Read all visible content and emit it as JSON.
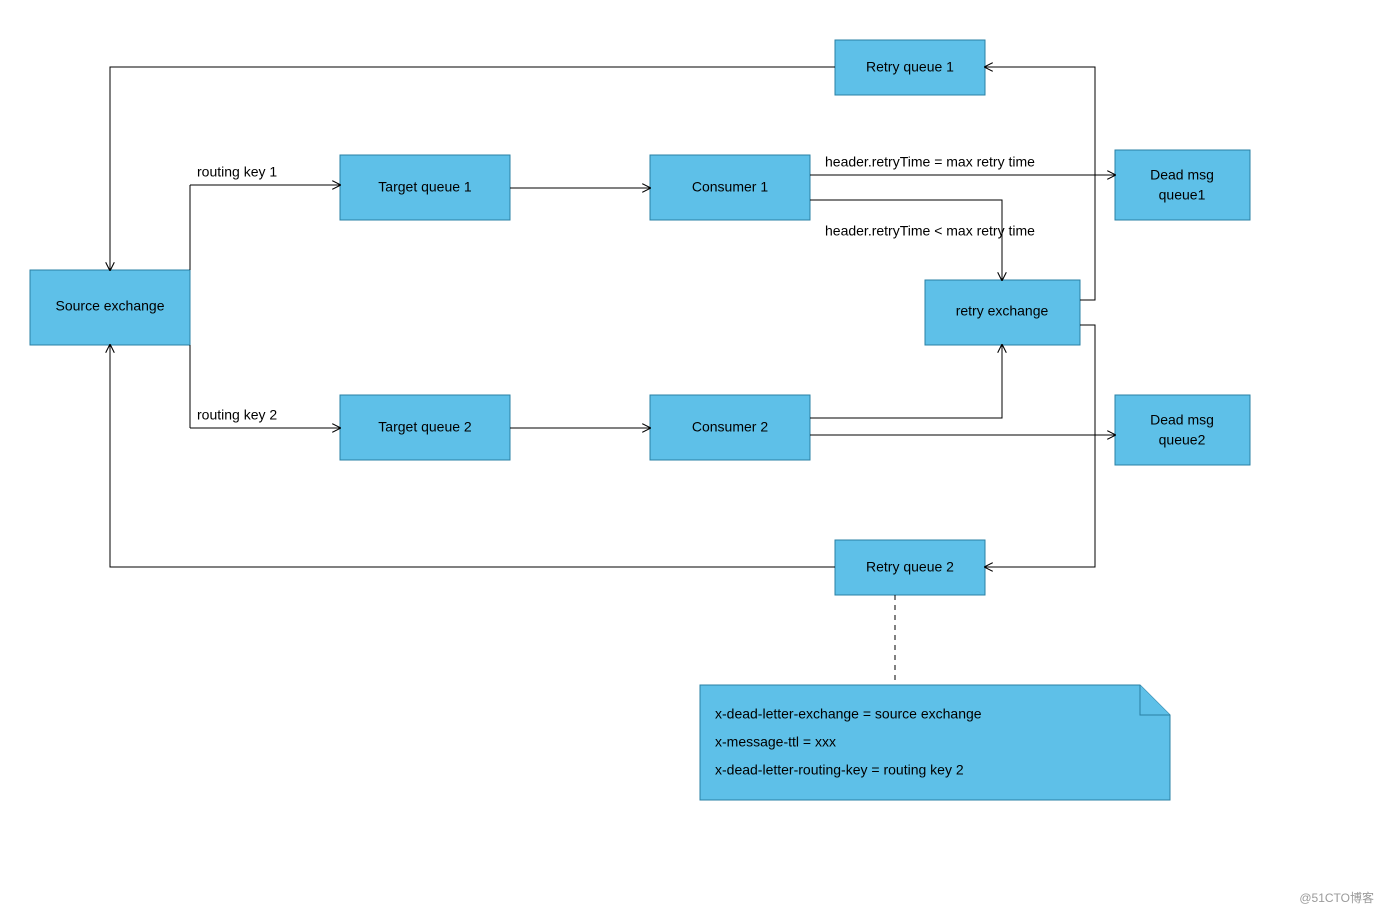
{
  "nodes": {
    "source_exchange": "Source exchange",
    "target_queue_1": "Target queue 1",
    "target_queue_2": "Target queue 2",
    "consumer_1": "Consumer 1",
    "consumer_2": "Consumer 2",
    "retry_exchange": "retry exchange",
    "retry_queue_1": "Retry queue 1",
    "retry_queue_2": "Retry queue 2",
    "dead_msg_queue_1_l1": "Dead msg",
    "dead_msg_queue_1_l2": "queue1",
    "dead_msg_queue_2_l1": "Dead msg",
    "dead_msg_queue_2_l2": "queue2"
  },
  "edges": {
    "routing_key_1": "routing key 1",
    "routing_key_2": "routing key 2",
    "retry_eq_max": "header.retryTime = max retry time",
    "retry_lt_max": "header.retryTime < max retry time"
  },
  "note": {
    "line1": "x-dead-letter-exchange = source exchange",
    "line2": "x-message-ttl = xxx",
    "line3": "x-dead-letter-routing-key = routing key 2"
  },
  "watermark": "@51CTO博客"
}
